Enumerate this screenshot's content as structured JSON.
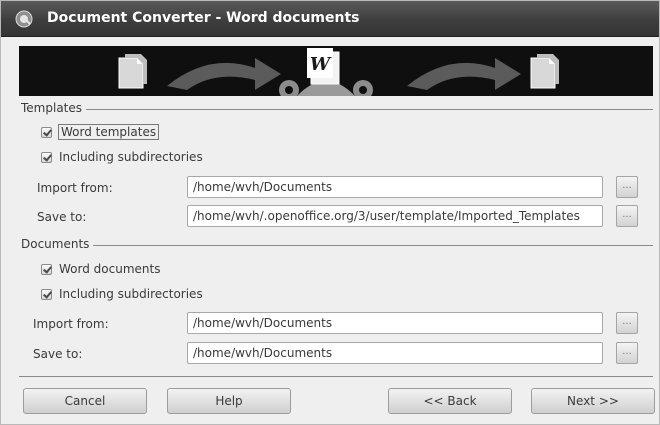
{
  "window": {
    "title": "Document Converter - Word documents"
  },
  "banner": {
    "center_icon_letter": "W"
  },
  "templates": {
    "section_label": "Templates",
    "word_templates_label": "Word templates",
    "word_templates_checked": true,
    "including_subdirs_label": "Including subdirectories",
    "including_subdirs_checked": true,
    "import_from_label": "Import from:",
    "import_from_value": "/home/wvh/Documents",
    "save_to_label": "Save to:",
    "save_to_value": "/home/wvh/.openoffice.org/3/user/template/Imported_Templates",
    "browse_label": "..."
  },
  "documents": {
    "section_label": "Documents",
    "word_documents_label": "Word documents",
    "word_documents_checked": true,
    "including_subdirs_label": "Including subdirectories",
    "including_subdirs_checked": true,
    "import_from_label": "Import from:",
    "import_from_value": "/home/wvh/Documents",
    "save_to_label": "Save to:",
    "save_to_value": "/home/wvh/Documents",
    "browse_label": "..."
  },
  "buttons": {
    "cancel": "Cancel",
    "help": "Help",
    "back": "<< Back",
    "next": "Next >>"
  }
}
